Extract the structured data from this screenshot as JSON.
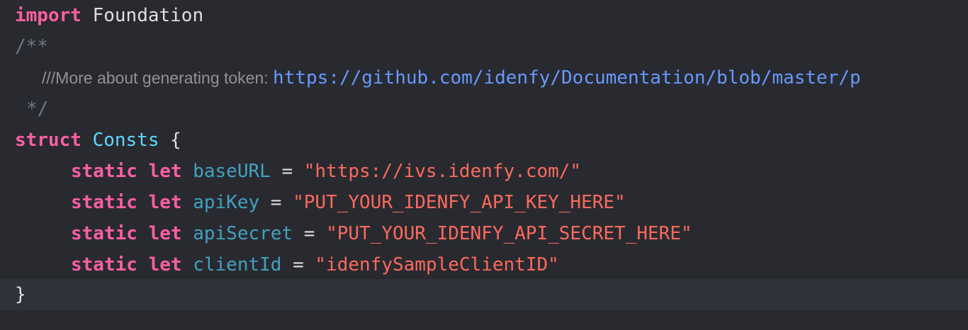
{
  "editor": {
    "lines": [
      {
        "keyword": "import",
        "module": "Foundation"
      },
      {
        "comment_open": "/**"
      },
      {
        "doc_text": "///More about generating token: ",
        "doc_link": "https://github.com/idenfy/Documentation/blob/master/p"
      },
      {
        "comment_close": "*/"
      },
      {
        "keyword": "struct",
        "type_name": "Consts",
        "brace_open": "{"
      },
      {
        "keyword1": "static",
        "keyword2": "let",
        "name": "baseURL",
        "equals": "=",
        "value": "\"https://ivs.idenfy.com/\""
      },
      {
        "keyword1": "static",
        "keyword2": "let",
        "name": "apiKey",
        "equals": "=",
        "value": "\"PUT_YOUR_IDENFY_API_KEY_HERE\""
      },
      {
        "keyword1": "static",
        "keyword2": "let",
        "name": "apiSecret",
        "equals": "=",
        "value": "\"PUT_YOUR_IDENFY_API_SECRET_HERE\""
      },
      {
        "keyword1": "static",
        "keyword2": "let",
        "name": "clientId",
        "equals": "=",
        "value": "\"idenfySampleClientID\""
      },
      {
        "brace_close": "}"
      }
    ]
  },
  "colors": {
    "background": "#292a30",
    "current_line": "#2f3239",
    "keyword": "#fc5fa3",
    "type": "#5dd8ff",
    "property": "#41a1c0",
    "string": "#fc6a5d",
    "comment": "#6c7986",
    "link": "#6699ff",
    "plain": "#dfdfe0"
  }
}
